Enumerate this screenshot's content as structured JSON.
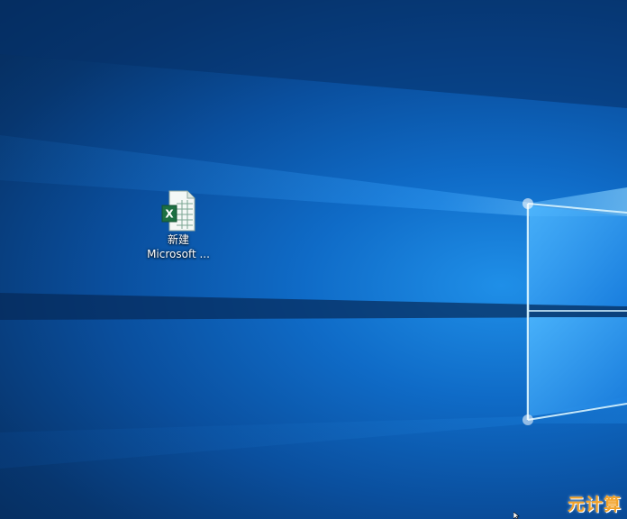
{
  "desktop": {
    "icons": [
      {
        "name_line1": "新建",
        "name_line2": "Microsoft ...",
        "icon": "excel-file-icon",
        "accent": "#1d6f42"
      }
    ]
  },
  "watermark": {
    "text": "元计算"
  },
  "colors": {
    "background_dark": "#052a58",
    "background_light": "#1f8fe8",
    "light_beam": "#bfe9ff"
  }
}
